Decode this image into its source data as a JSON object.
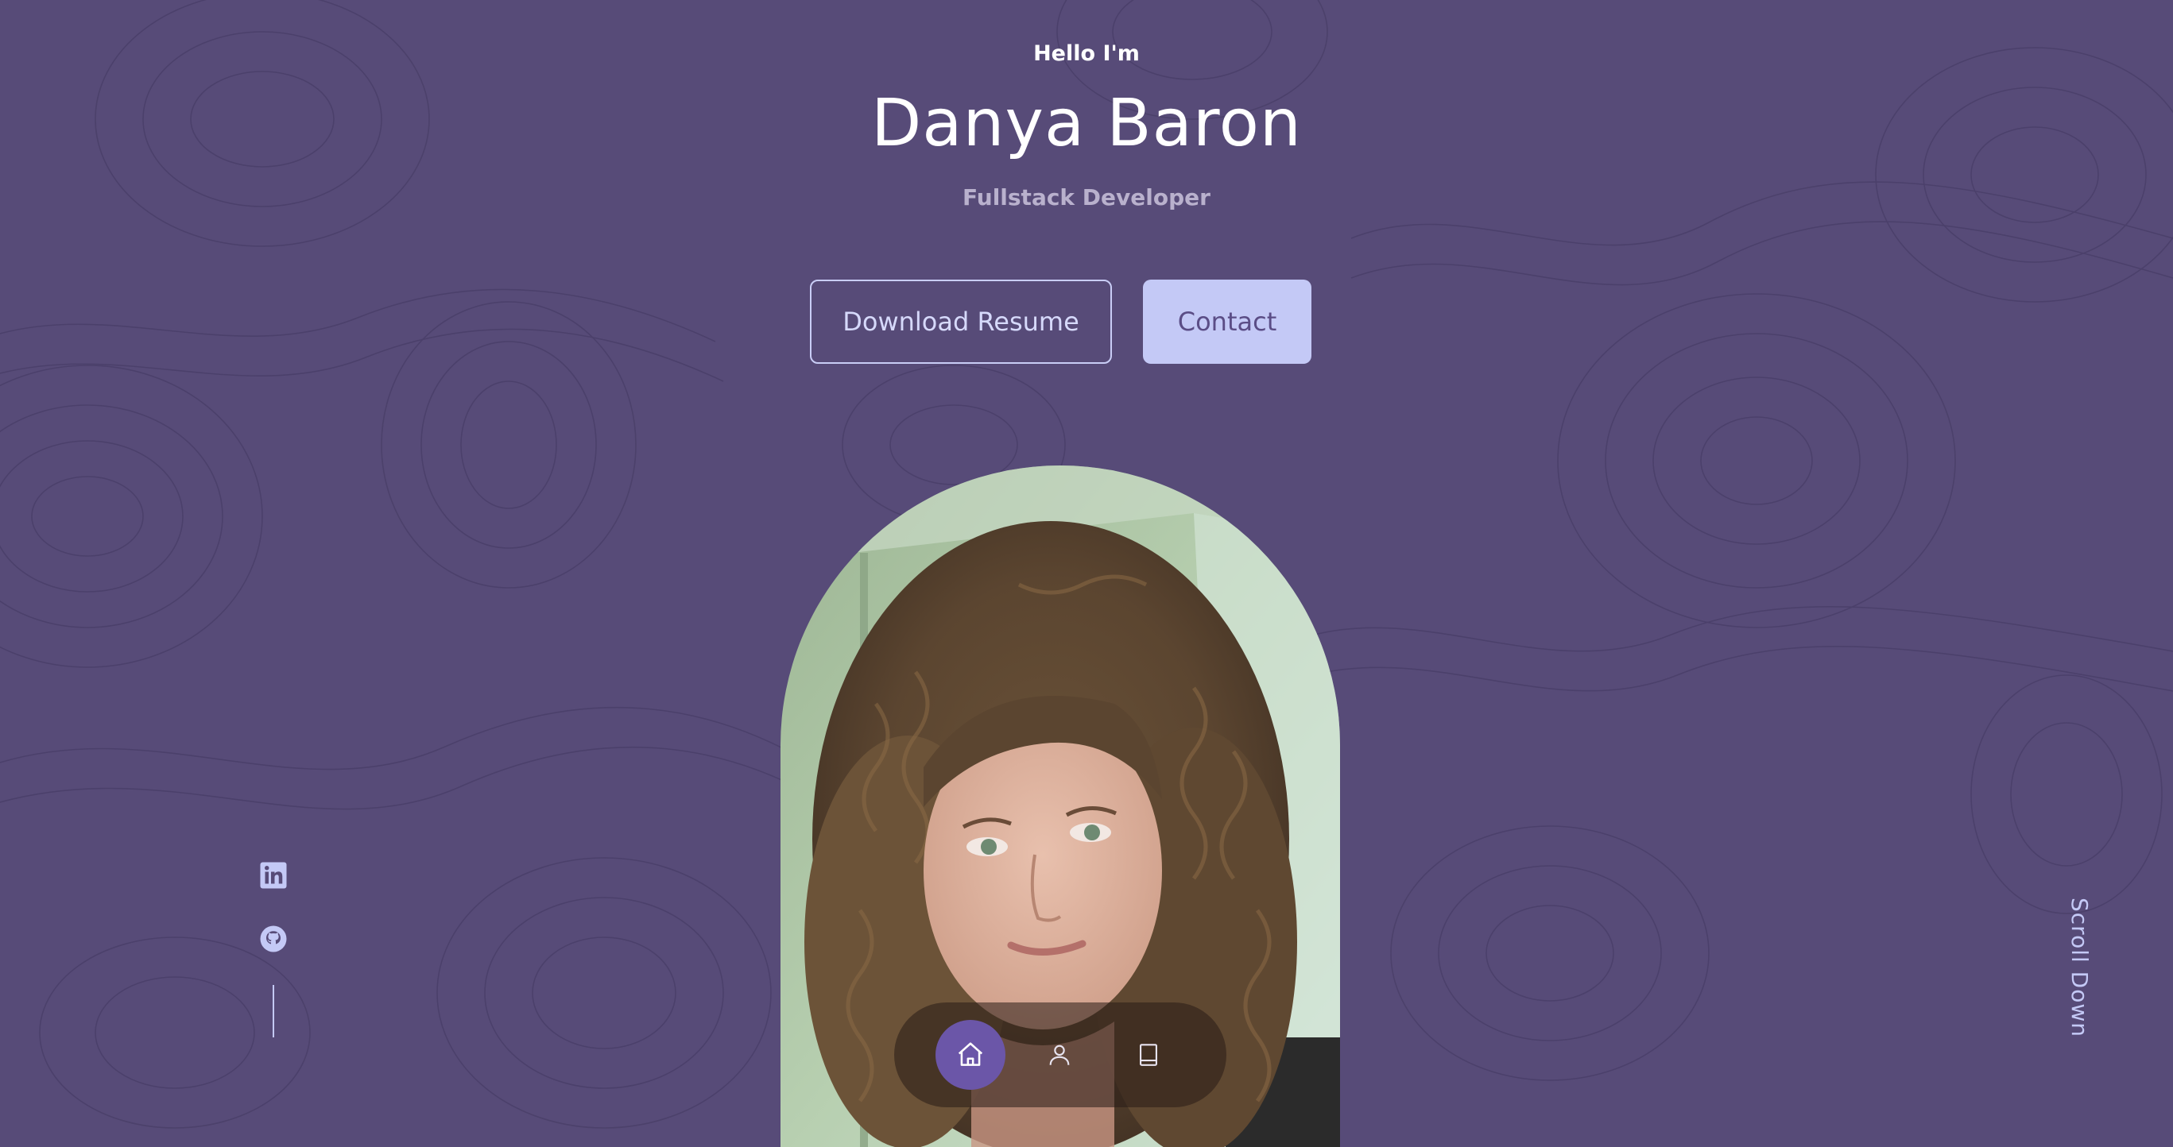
{
  "hero": {
    "greeting": "Hello I'm",
    "name": "Danya Baron",
    "role": "Fullstack Developer"
  },
  "actions": {
    "resume_label": "Download Resume",
    "contact_label": "Contact"
  },
  "dock": {
    "items": [
      {
        "icon": "home-icon",
        "active": true
      },
      {
        "icon": "user-icon",
        "active": false
      },
      {
        "icon": "book-icon",
        "active": false
      }
    ]
  },
  "social": {
    "links": [
      {
        "icon": "linkedin-icon"
      },
      {
        "icon": "github-icon"
      }
    ]
  },
  "scroll": {
    "label": "Scroll Down"
  },
  "colors": {
    "background": "#574b78",
    "accent": "#c4c9f6",
    "active_dock": "#6b56a8",
    "subtitle": "#b9b1cd"
  }
}
